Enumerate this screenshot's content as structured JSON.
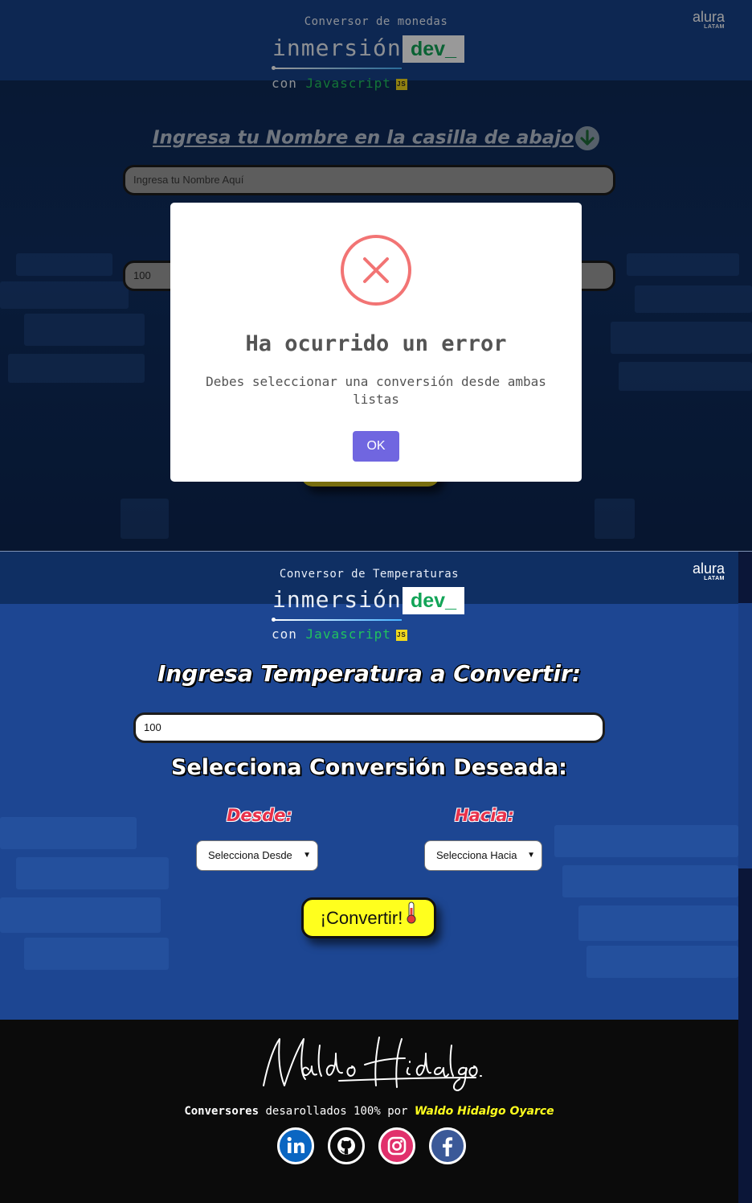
{
  "currency_section": {
    "subtitle": "Conversor de monedas",
    "logo": {
      "inmersion": "inmersión",
      "dev": "dev_",
      "con": "con",
      "javascript": "Javascript",
      "js_badge": "JS"
    },
    "alura": {
      "name": "alura",
      "region": "LATAM"
    },
    "name_prompt": "Ingresa tu Nombre en la casilla de abajo",
    "name_placeholder": "Ingresa tu Nombre Aquí",
    "amount_value": "100"
  },
  "modal": {
    "title": "Ha ocurrido un error",
    "message": "Debes seleccionar una conversión desde ambas listas",
    "ok_label": "OK",
    "icon": "error-x-icon",
    "icon_color": "#f27474",
    "button_color": "#7066e0"
  },
  "temperature_section": {
    "subtitle": "Conversor de Temperaturas",
    "logo": {
      "inmersion": "inmersión",
      "dev": "dev_",
      "con": "con",
      "javascript": "Javascript",
      "js_badge": "JS"
    },
    "alura": {
      "name": "alura",
      "region": "LATAM"
    },
    "input_title": "Ingresa Temperatura a Convertir:",
    "input_value": "100",
    "select_title": "Selecciona Conversión Deseada:",
    "from_label": "Desde:",
    "to_label": "Hacia:",
    "from_select": "Selecciona Desde",
    "to_select": "Selecciona Hacia",
    "convert_label": "¡Convertir!",
    "convert_color": "#ffff1e"
  },
  "footer": {
    "signature": "Waldo Hidalgo.",
    "credits_prefix": "Conversores",
    "credits_middle": " desarollados 100% por ",
    "credits_author": "Waldo Hidalgo Oyarce",
    "social": [
      "linkedin-icon",
      "github-icon",
      "instagram-icon",
      "facebook-icon"
    ]
  }
}
